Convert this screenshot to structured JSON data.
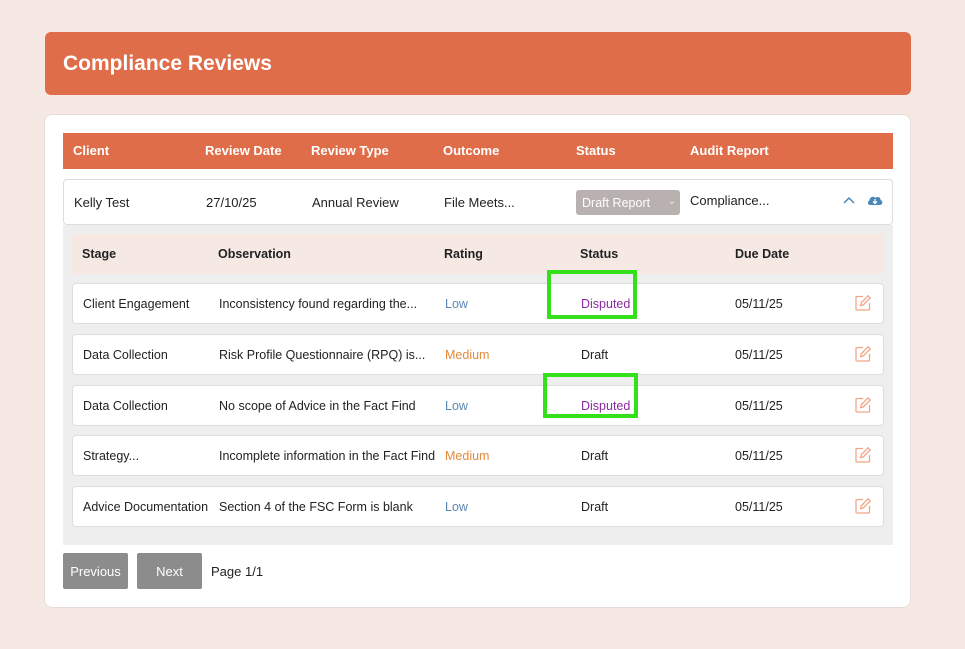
{
  "header": {
    "title": "Compliance Reviews"
  },
  "table": {
    "columns": [
      "Client",
      "Review Date",
      "Review Type",
      "Outcome",
      "Status",
      "Audit Report"
    ],
    "row": {
      "client": "Kelly Test",
      "review_date": "27/10/25",
      "review_type": "Annual Review",
      "outcome": "File Meets...",
      "status": "Draft Report",
      "audit_report": "Compliance..."
    }
  },
  "stages": {
    "columns": [
      "Stage",
      "Observation",
      "Rating",
      "Status",
      "Due Date"
    ],
    "rows": [
      {
        "stage": "Client Engagement",
        "observation": "Inconsistency found regarding the...",
        "rating": "Low",
        "status": "Disputed",
        "due": "05/11/25"
      },
      {
        "stage": "Data Collection",
        "observation": "Risk Profile Questionnaire (RPQ) is...",
        "rating": "Medium",
        "status": "Draft",
        "due": "05/11/25"
      },
      {
        "stage": "Data Collection",
        "observation": "No scope of Advice in the Fact Find",
        "rating": "Low",
        "status": "Disputed",
        "due": "05/11/25"
      },
      {
        "stage": "Strategy...",
        "observation": "Incomplete information in the Fact Find",
        "rating": "Medium",
        "status": "Draft",
        "due": "05/11/25"
      },
      {
        "stage": "Advice Documentation",
        "observation": "Section 4 of the FSC Form is blank",
        "rating": "Low",
        "status": "Draft",
        "due": "05/11/25"
      }
    ]
  },
  "pagination": {
    "previous": "Previous",
    "next": "Next",
    "page": "Page 1/1"
  },
  "colors": {
    "accent": "#e06d49",
    "highlight": "#33e019",
    "disputed": "#8c2aa0",
    "low": "#5b86b6",
    "medium": "#e38a3a"
  }
}
